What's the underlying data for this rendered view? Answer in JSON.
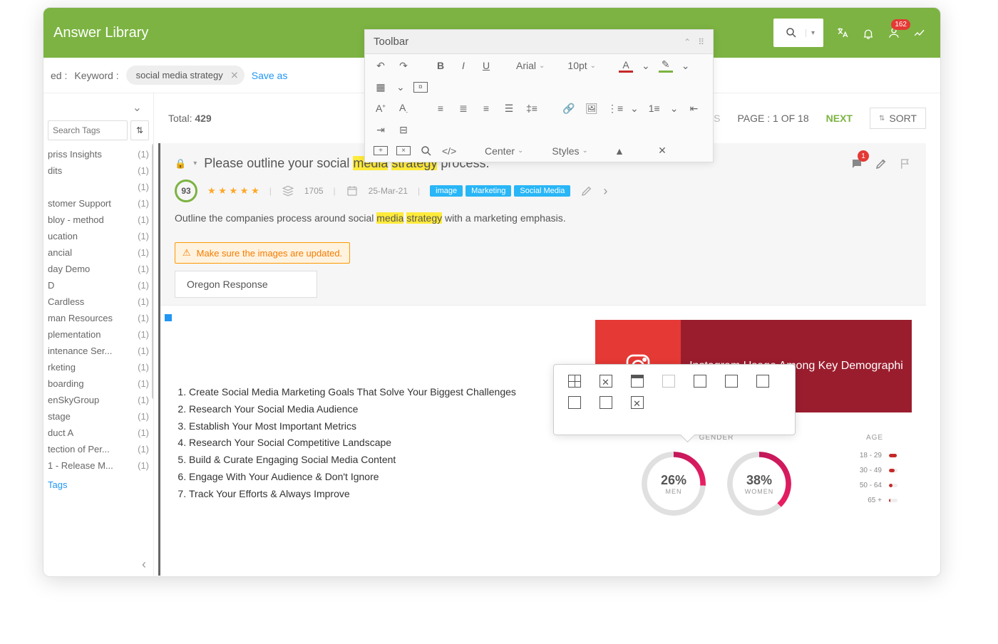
{
  "header": {
    "title": "Answer Library",
    "notificationCount": "162"
  },
  "filters": {
    "label": "ed :",
    "keywordLabel": "Keyword :",
    "keywordValue": "social media strategy",
    "saveAs": "Save as"
  },
  "sidebar": {
    "searchPlaceholder": "Search Tags",
    "tags": [
      {
        "name": "priss Insights",
        "count": "(1)"
      },
      {
        "name": "dits",
        "count": "(1)"
      },
      {
        "name": "",
        "count": "(1)"
      },
      {
        "name": "stomer Support",
        "count": "(1)"
      },
      {
        "name": "bloy - method",
        "count": "(1)"
      },
      {
        "name": "ucation",
        "count": "(1)"
      },
      {
        "name": "ancial",
        "count": "(1)"
      },
      {
        "name": "day Demo",
        "count": "(1)"
      },
      {
        "name": "D",
        "count": "(1)"
      },
      {
        "name": "Cardless",
        "count": "(1)"
      },
      {
        "name": "man Resources",
        "count": "(1)"
      },
      {
        "name": "plementation",
        "count": "(1)"
      },
      {
        "name": "intenance Ser...",
        "count": "(1)"
      },
      {
        "name": "rketing",
        "count": "(1)"
      },
      {
        "name": "boarding",
        "count": "(1)"
      },
      {
        "name": "enSkyGroup",
        "count": "(1)"
      },
      {
        "name": "stage",
        "count": "(1)"
      },
      {
        "name": "duct A",
        "count": "(1)"
      },
      {
        "name": "tection of Per...",
        "count": "(1)"
      },
      {
        "name": "1 - Release M...",
        "count": "(1)"
      }
    ],
    "bottomLink": "Tags"
  },
  "contentBar": {
    "totalLabel": "Total:",
    "totalValue": "429",
    "previous": "VIOUS",
    "pageInfo": "PAGE : 1 OF 18",
    "next": "NEXT",
    "sort": "SORT"
  },
  "toolbar": {
    "title": "Toolbar",
    "font": "Arial",
    "size": "10pt",
    "align": "Center",
    "styles": "Styles"
  },
  "answer": {
    "titlePrefix": "Please outline your social ",
    "titleHl1": "media",
    "titleMid": " ",
    "titleHl2": "strategy",
    "titleSuffix": " process.",
    "score": "93",
    "views": "1705",
    "date": "25-Mar-21",
    "tags": [
      "image",
      "Marketing",
      "Social Media"
    ],
    "subtitlePrefix": "Outline the companies process around social ",
    "subtitleHl1": "media",
    "subtitleMid": " ",
    "subtitleHl2": "strategy",
    "subtitleSuffix": " with a marketing emphasis.",
    "warning": "Make sure the images are updated.",
    "responseTab": "Oregon Response",
    "commentCount": "1",
    "steps": [
      "Create Social Media Marketing Goals That Solve Your Biggest Challenges",
      "Research Your Social Media Audience",
      "Establish Your Most Important Metrics",
      "Research Your Social Competitive Landscape",
      "Build & Curate Engaging Social Media Content",
      "Engage With Your Audience & Don't Ignore",
      "Track Your Efforts & Always Improve"
    ]
  },
  "chart_data": {
    "type": "infographic",
    "title": "Instagram Usage Among Key Demographi",
    "sections": {
      "gender": {
        "label": "GENDER",
        "series": [
          {
            "name": "MEN",
            "value": 26
          },
          {
            "name": "WOMEN",
            "value": 38
          }
        ]
      },
      "age": {
        "label": "AGE",
        "categories": [
          "18 - 29",
          "30 - 49",
          "50 - 64",
          "65 +"
        ],
        "values": [
          90,
          70,
          45,
          18
        ]
      }
    }
  }
}
